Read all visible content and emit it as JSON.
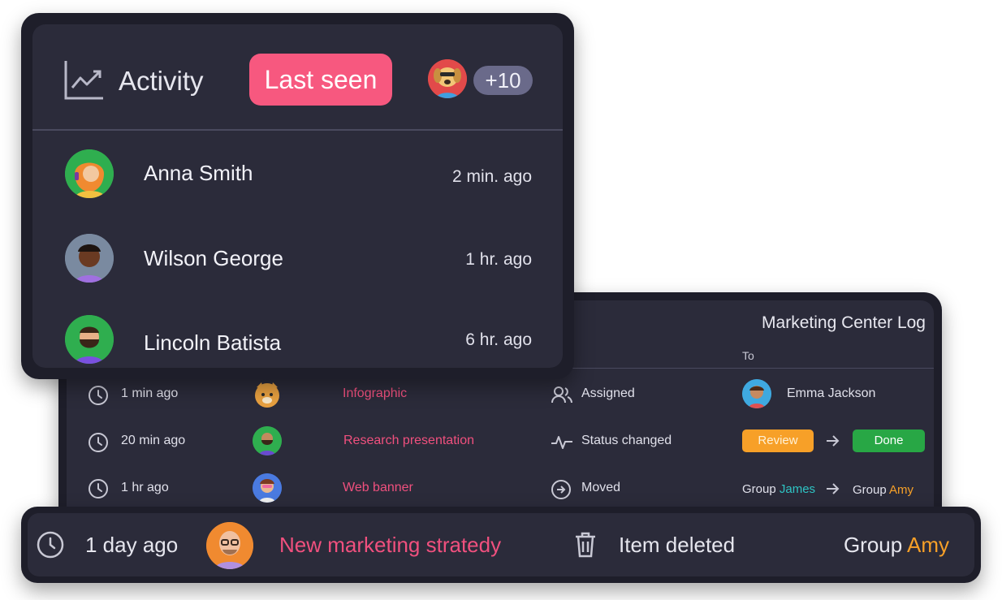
{
  "activity": {
    "title": "Activity",
    "last_seen_button": "Last seen",
    "extra_count": "+10",
    "users": [
      {
        "name": "Anna Smith",
        "time": "2 min. ago"
      },
      {
        "name": "Wilson George",
        "time": "1 hr. ago"
      },
      {
        "name": "Lincoln Batista",
        "time": "6 hr. ago"
      }
    ]
  },
  "log": {
    "title": "Marketing Center Log",
    "column_to": "To",
    "rows": [
      {
        "time": "1 min ago",
        "item": "Infographic",
        "action": "Assigned",
        "to_name": "Emma Jackson"
      },
      {
        "time": "20 min ago",
        "item": "Research presentation",
        "action": "Status changed",
        "from_status": "Review",
        "to_status": "Done"
      },
      {
        "time": "1 hr ago",
        "item": "Web banner",
        "action": "Moved",
        "from_group_label": "Group",
        "from_group_name": "James",
        "to_group_label": "Group",
        "to_group_name": "Amy"
      }
    ]
  },
  "bottom_bar": {
    "time": "1 day ago",
    "item": "New marketing stratedy",
    "action": "Item deleted",
    "group_label": "Group",
    "group_name": "Amy"
  },
  "colors": {
    "accent_pink": "#f0507e",
    "button_pink": "#f7587f",
    "amber": "#f7a028",
    "teal": "#2ec4c4",
    "green": "#28a745",
    "badge_bg": "#6a6a8a"
  }
}
